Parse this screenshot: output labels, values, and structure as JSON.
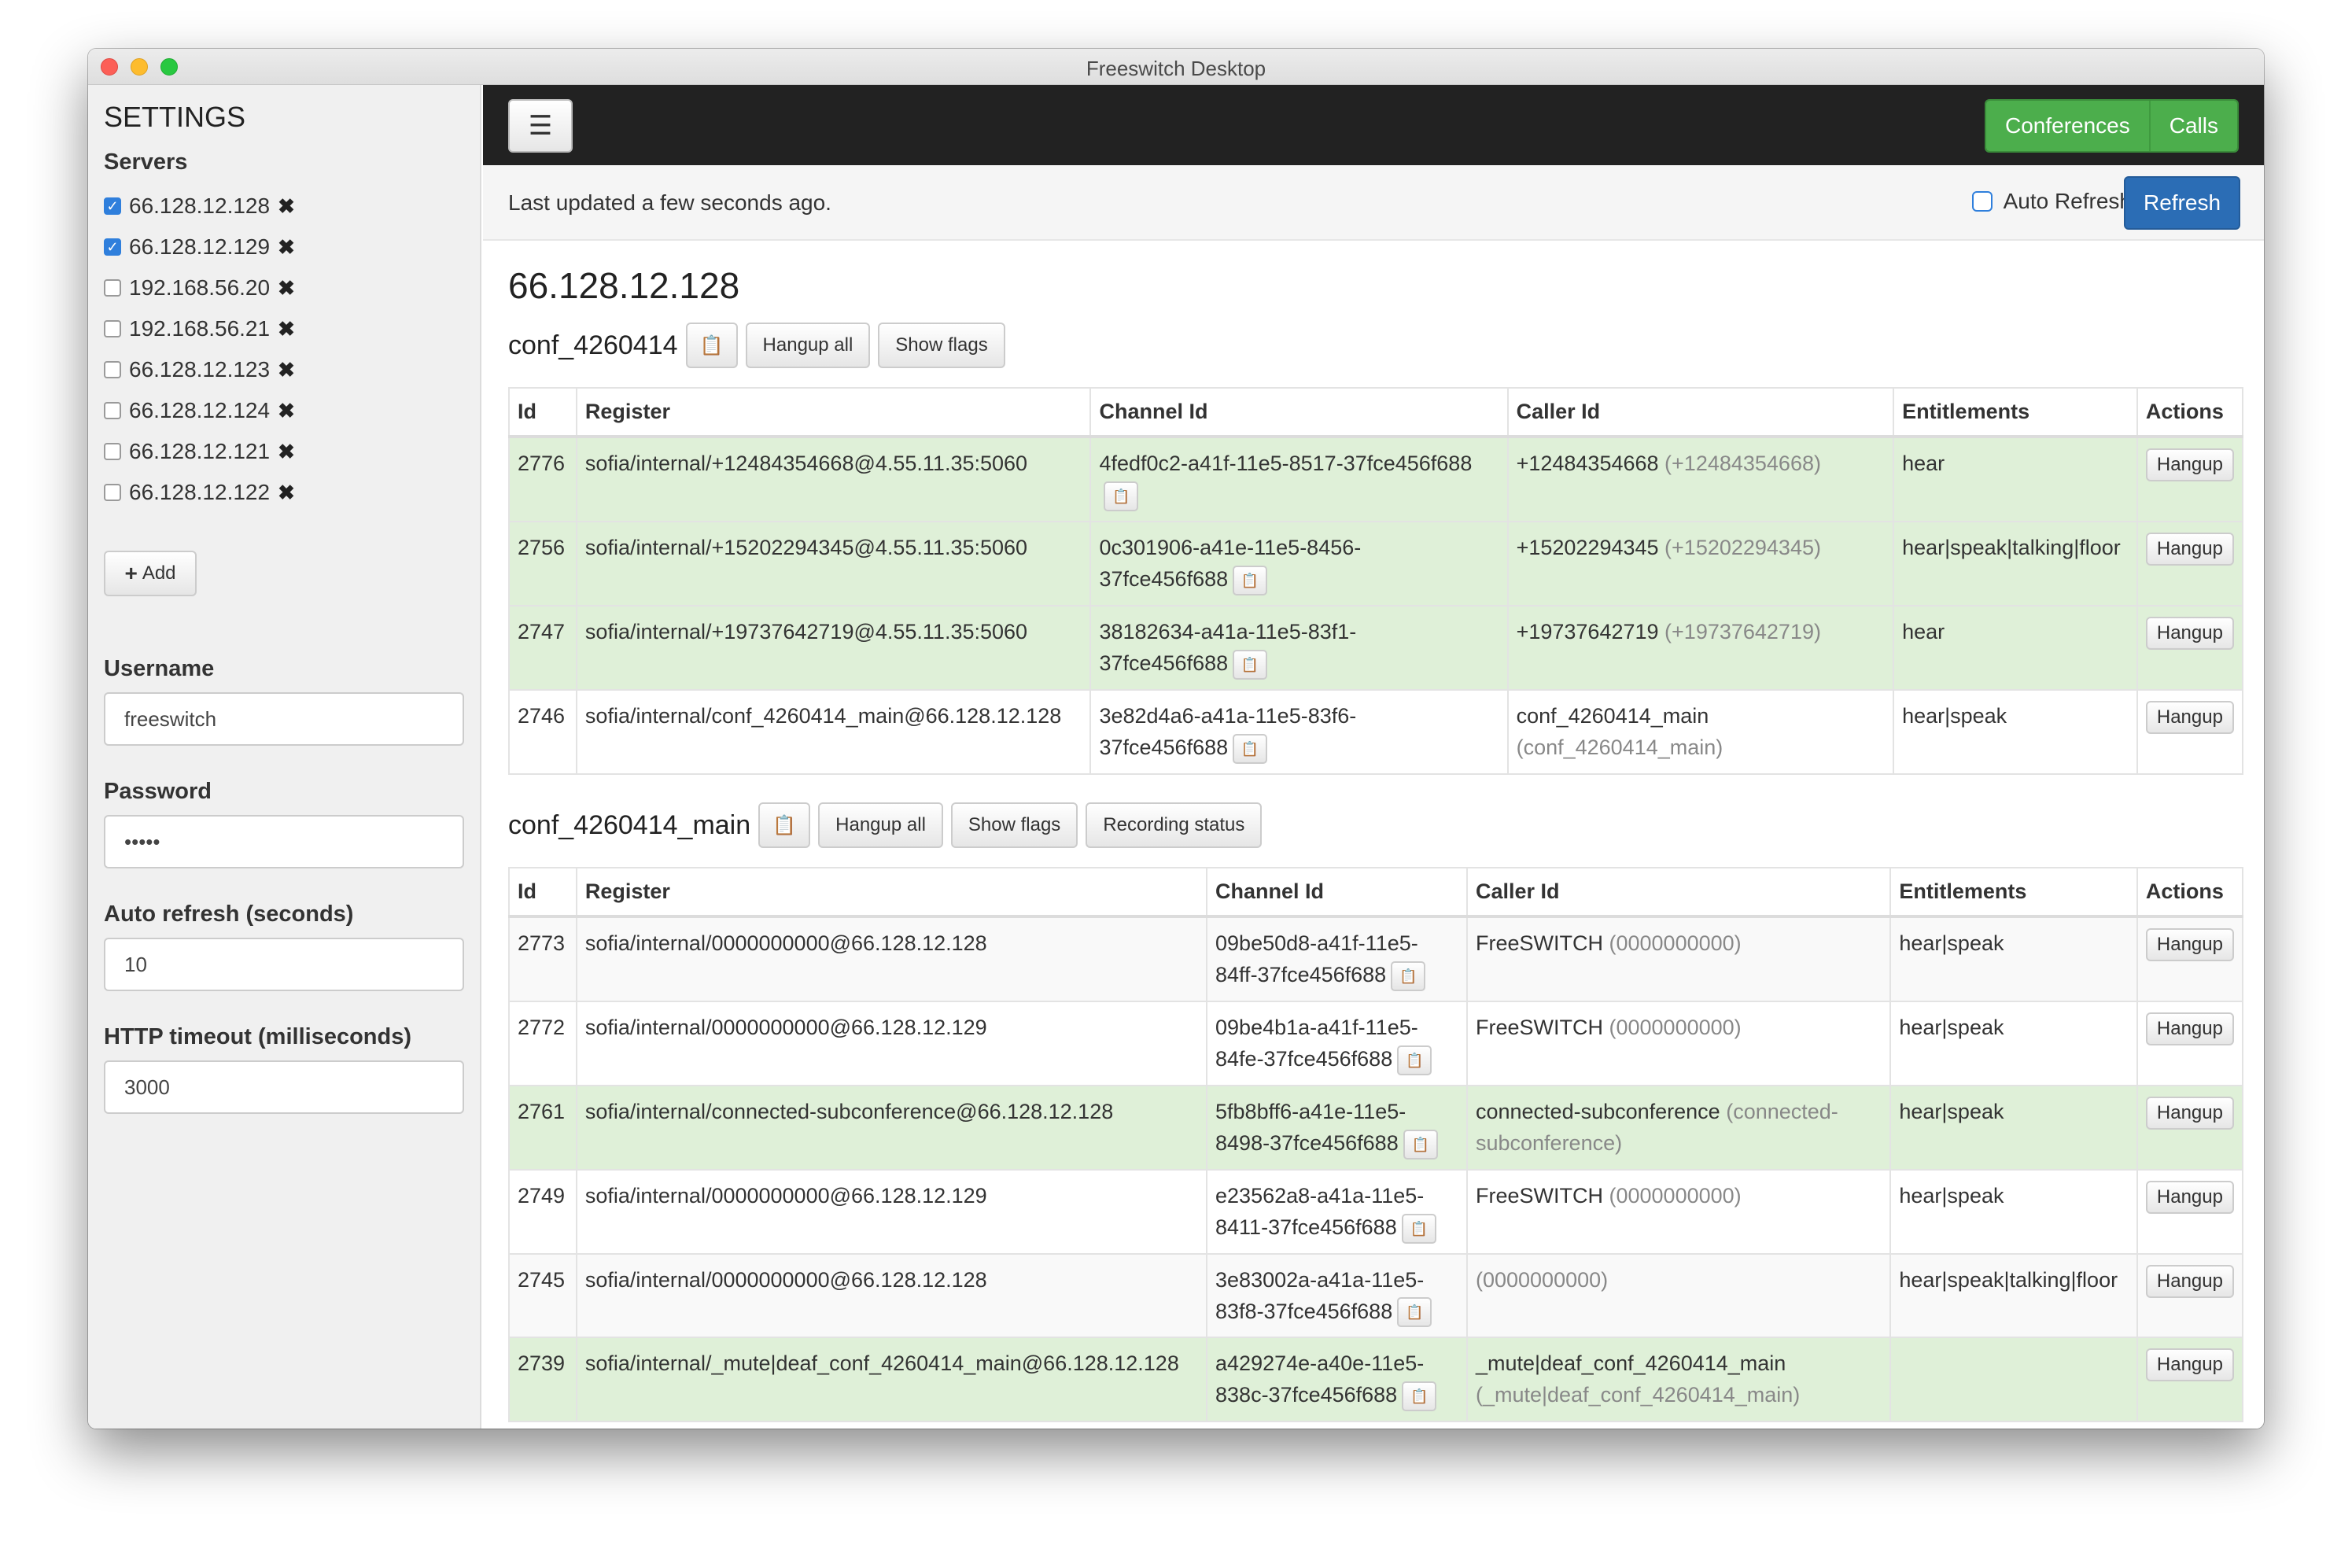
{
  "window": {
    "title": "Freeswitch Desktop"
  },
  "sidebar": {
    "title": "SETTINGS",
    "servers_label": "Servers",
    "servers": [
      {
        "ip": "66.128.12.128",
        "checked": true
      },
      {
        "ip": "66.128.12.129",
        "checked": true
      },
      {
        "ip": "192.168.56.20",
        "checked": false
      },
      {
        "ip": "192.168.56.21",
        "checked": false
      },
      {
        "ip": "66.128.12.123",
        "checked": false
      },
      {
        "ip": "66.128.12.124",
        "checked": false
      },
      {
        "ip": "66.128.12.121",
        "checked": false
      },
      {
        "ip": "66.128.12.122",
        "checked": false
      }
    ],
    "add_label": "Add",
    "username_label": "Username",
    "username_value": "freeswitch",
    "password_label": "Password",
    "password_value": "•••••",
    "autorefresh_label": "Auto refresh (seconds)",
    "autorefresh_value": "10",
    "timeout_label": "HTTP timeout (milliseconds)",
    "timeout_value": "3000"
  },
  "topbar": {
    "conferences_label": "Conferences",
    "calls_label": "Calls",
    "nav_color": "#4cae4c"
  },
  "infobar": {
    "updated_text": "Last updated a few seconds ago.",
    "auto_refresh_label": "Auto Refresh",
    "refresh_label": "Refresh"
  },
  "server_heading": "66.128.12.128",
  "headers": [
    "Id",
    "Register",
    "Channel Id",
    "Caller Id",
    "Entitlements",
    "Actions"
  ],
  "conf1": {
    "name": "conf_4260414",
    "hangup_all": "Hangup all",
    "show_flags": "Show flags",
    "rows": [
      {
        "id": "2776",
        "register": "sofia/internal/+12484354668@4.55.11.35:5060",
        "channel1": "4fedf0c2-a41f-11e5-8517-37fce456f688",
        "channel2": "",
        "caller": "+12484354668",
        "caller_muted": "(+12484354668)",
        "ent": "hear",
        "action": "Hangup",
        "style": "green"
      },
      {
        "id": "2756",
        "register": "sofia/internal/+15202294345@4.55.11.35:5060",
        "channel1": "0c301906-a41e-11e5-8456-",
        "channel2": "37fce456f688",
        "caller": "+15202294345",
        "caller_muted": "(+15202294345)",
        "ent": "hear|speak|talking|floor",
        "action": "Hangup",
        "style": "green"
      },
      {
        "id": "2747",
        "register": "sofia/internal/+19737642719@4.55.11.35:5060",
        "channel1": "38182634-a41a-11e5-83f1-",
        "channel2": "37fce456f688",
        "caller": "+19737642719",
        "caller_muted": "(+19737642719)",
        "ent": "hear",
        "action": "Hangup",
        "style": "green"
      },
      {
        "id": "2746",
        "register": "sofia/internal/conf_4260414_main@66.128.12.128",
        "channel1": "3e82d4a6-a41a-11e5-83f6-",
        "channel2": "37fce456f688",
        "caller": "conf_4260414_main",
        "caller_muted": "(conf_4260414_main)",
        "ent": "hear|speak",
        "action": "Hangup",
        "style": "white"
      }
    ]
  },
  "conf2": {
    "name": "conf_4260414_main",
    "hangup_all": "Hangup all",
    "show_flags": "Show flags",
    "recording_status": "Recording status",
    "rows": [
      {
        "id": "2773",
        "register": "sofia/internal/0000000000@66.128.12.128",
        "channel1": "09be50d8-a41f-11e5-",
        "channel2": "84ff-37fce456f688",
        "caller": "FreeSWITCH",
        "caller_muted": "(0000000000)",
        "ent": "hear|speak",
        "action": "Hangup",
        "style": "stripe"
      },
      {
        "id": "2772",
        "register": "sofia/internal/0000000000@66.128.12.129",
        "channel1": "09be4b1a-a41f-11e5-",
        "channel2": "84fe-37fce456f688",
        "caller": "FreeSWITCH",
        "caller_muted": "(0000000000)",
        "ent": "hear|speak",
        "action": "Hangup",
        "style": "white"
      },
      {
        "id": "2761",
        "register": "sofia/internal/connected-subconference@66.128.12.128",
        "channel1": "5fb8bff6-a41e-11e5-",
        "channel2": "8498-37fce456f688",
        "caller": "connected-subconference",
        "caller_muted": "(connected-subconference)",
        "ent": "hear|speak",
        "action": "Hangup",
        "style": "green"
      },
      {
        "id": "2749",
        "register": "sofia/internal/0000000000@66.128.12.129",
        "channel1": "e23562a8-a41a-11e5-",
        "channel2": "8411-37fce456f688",
        "caller": "FreeSWITCH",
        "caller_muted": "(0000000000)",
        "ent": "hear|speak",
        "action": "Hangup",
        "style": "white"
      },
      {
        "id": "2745",
        "register": "sofia/internal/0000000000@66.128.12.128",
        "channel1": "3e83002a-a41a-11e5-",
        "channel2": "83f8-37fce456f688",
        "caller": "",
        "caller_muted": "(0000000000)",
        "ent": "hear|speak|talking|floor",
        "action": "Hangup",
        "style": "stripe"
      },
      {
        "id": "2739",
        "register": "sofia/internal/_mute|deaf_conf_4260414_main@66.128.12.128",
        "channel1": "a429274e-a40e-11e5-",
        "channel2": "838c-37fce456f688",
        "caller": "_mute|deaf_conf_4260414_main",
        "caller_muted": "(_mute|deaf_conf_4260414_main)",
        "ent": "",
        "action": "Hangup",
        "style": "green"
      }
    ]
  }
}
